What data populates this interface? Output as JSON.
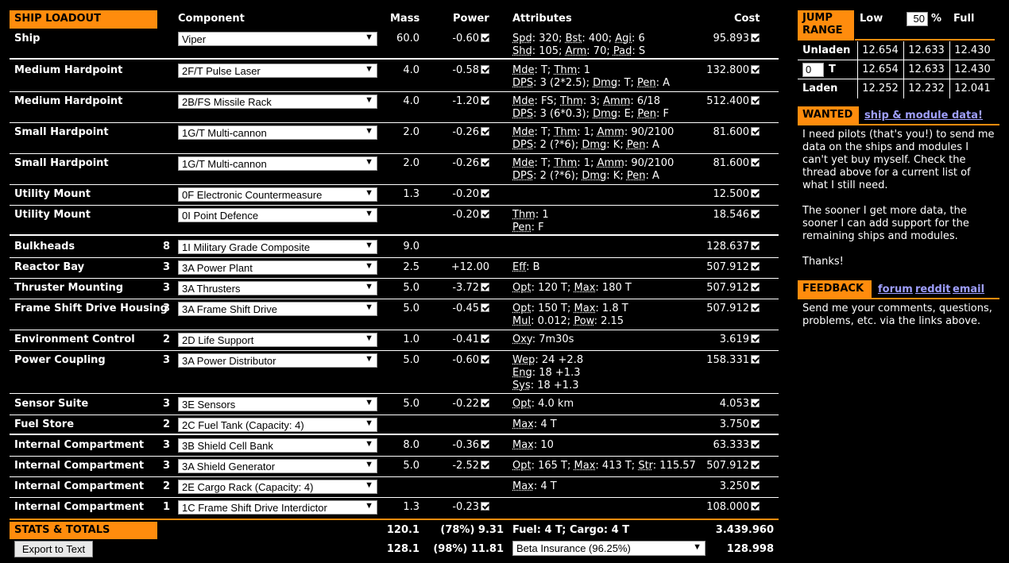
{
  "loadout": {
    "title": "SHIP LOADOUT",
    "headers": {
      "component": "Component",
      "mass": "Mass",
      "power": "Power",
      "attributes": "Attributes",
      "cost": "Cost"
    },
    "rows": [
      {
        "name": "Ship",
        "cls": "",
        "component": "Viper",
        "mass": "60.0",
        "power": "-0.60",
        "attr1": "Spd: 320; Bst: 400; Agi: 6",
        "attr2": "Shd: 105; Arm: 70; Pad: S",
        "attr3": "",
        "cost": "95.893"
      },
      {
        "name": "Medium Hardpoint",
        "cls": "",
        "component": "2F/T Pulse Laser",
        "mass": "4.0",
        "power": "-0.58",
        "attr1": "Mde: T; Thm: 1",
        "attr2": "DPS: 3 (2*2.5); Dmg: T; Pen: A",
        "attr3": "",
        "cost": "132.800"
      },
      {
        "name": "Medium Hardpoint",
        "cls": "",
        "component": "2B/FS Missile Rack",
        "mass": "4.0",
        "power": "-1.20",
        "attr1": "Mde: FS; Thm: 3; Amm: 6/18",
        "attr2": "DPS: 3 (6*0.3); Dmg: E; Pen: F",
        "attr3": "",
        "cost": "512.400"
      },
      {
        "name": "Small Hardpoint",
        "cls": "",
        "component": "1G/T Multi-cannon",
        "mass": "2.0",
        "power": "-0.26",
        "attr1": "Mde: T; Thm: 1; Amm: 90/2100",
        "attr2": "DPS: 2 (?*6); Dmg: K; Pen: A",
        "attr3": "",
        "cost": "81.600"
      },
      {
        "name": "Small Hardpoint",
        "cls": "",
        "component": "1G/T Multi-cannon",
        "mass": "2.0",
        "power": "-0.26",
        "attr1": "Mde: T; Thm: 1; Amm: 90/2100",
        "attr2": "DPS: 2 (?*6); Dmg: K; Pen: A",
        "attr3": "",
        "cost": "81.600"
      },
      {
        "name": "Utility Mount",
        "cls": "",
        "component": "0F Electronic Countermeasure",
        "mass": "1.3",
        "power": "-0.20",
        "attr1": "",
        "attr2": "",
        "attr3": "",
        "cost": "12.500"
      },
      {
        "name": "Utility Mount",
        "cls": "",
        "component": "0I Point Defence",
        "mass": "",
        "power": "-0.20",
        "attr1": "Thm: 1",
        "attr2": "Pen: F",
        "attr3": "",
        "cost": "18.546"
      },
      {
        "name": "Bulkheads",
        "cls": "8",
        "component": "1I Military Grade Composite",
        "mass": "9.0",
        "power": "",
        "attr1": "",
        "attr2": "",
        "attr3": "",
        "cost": "128.637"
      },
      {
        "name": "Reactor Bay",
        "cls": "3",
        "component": "3A Power Plant",
        "mass": "2.5",
        "power": "+12.00",
        "attr1": "Eff: B",
        "attr2": "",
        "attr3": "",
        "cost": "507.912"
      },
      {
        "name": "Thruster Mounting",
        "cls": "3",
        "component": "3A Thrusters",
        "mass": "5.0",
        "power": "-3.72",
        "attr1": "Opt: 120 T; Max: 180 T",
        "attr2": "",
        "attr3": "",
        "cost": "507.912"
      },
      {
        "name": "Frame Shift Drive Housing",
        "cls": "3",
        "component": "3A Frame Shift Drive",
        "mass": "5.0",
        "power": "-0.45",
        "attr1": "Opt: 150 T; Max: 1.8 T",
        "attr2": "Mul: 0.012; Pow: 2.15",
        "attr3": "",
        "cost": "507.912"
      },
      {
        "name": "Environment Control",
        "cls": "2",
        "component": "2D Life Support",
        "mass": "1.0",
        "power": "-0.41",
        "attr1": "Oxy: 7m30s",
        "attr2": "",
        "attr3": "",
        "cost": "3.619"
      },
      {
        "name": "Power Coupling",
        "cls": "3",
        "component": "3A Power Distributor",
        "mass": "5.0",
        "power": "-0.60",
        "attr1": "Wep: 24 +2.8",
        "attr2": "Eng: 18 +1.3",
        "attr3": "Sys: 18 +1.3",
        "cost": "158.331"
      },
      {
        "name": "Sensor Suite",
        "cls": "3",
        "component": "3E Sensors",
        "mass": "5.0",
        "power": "-0.22",
        "attr1": "Opt: 4.0 km",
        "attr2": "",
        "attr3": "",
        "cost": "4.053"
      },
      {
        "name": "Fuel Store",
        "cls": "2",
        "component": "2C Fuel Tank (Capacity: 4)",
        "mass": "",
        "power": "",
        "attr1": "Max: 4 T",
        "attr2": "",
        "attr3": "",
        "cost": "3.750"
      },
      {
        "name": "Internal Compartment",
        "cls": "3",
        "component": "3B Shield Cell Bank",
        "mass": "8.0",
        "power": "-0.36",
        "attr1": "Max: 10",
        "attr2": "",
        "attr3": "",
        "cost": "63.333"
      },
      {
        "name": "Internal Compartment",
        "cls": "3",
        "component": "3A Shield Generator",
        "mass": "5.0",
        "power": "-2.52",
        "attr1": "Opt: 165 T; Max: 413 T; Str: 115.57",
        "attr2": "",
        "attr3": "",
        "cost": "507.912"
      },
      {
        "name": "Internal Compartment",
        "cls": "2",
        "component": "2E Cargo Rack (Capacity: 4)",
        "mass": "",
        "power": "",
        "attr1": "Max: 4 T",
        "attr2": "",
        "attr3": "",
        "cost": "3.250"
      },
      {
        "name": "Internal Compartment",
        "cls": "1",
        "component": "1C Frame Shift Drive Interdictor",
        "mass": "1.3",
        "power": "-0.23",
        "attr1": "",
        "attr2": "",
        "attr3": "",
        "cost": "108.000"
      }
    ]
  },
  "totals": {
    "title": "STATS & TOTALS",
    "mass1": "120.1",
    "power1": "(78%) 9.31",
    "fuel_cargo": "Fuel: 4 T; Cargo: 4 T",
    "cost1": "3.439.960",
    "export_label": "Export to Text",
    "mass2": "128.1",
    "power2": "(98%) 11.81",
    "insurance": "Beta Insurance (96.25%)",
    "cost2": "128.998"
  },
  "jump": {
    "title_line1": "JUMP",
    "title_line2": "RANGE",
    "low": "Low",
    "pct_value": "50",
    "pct_sign": "%",
    "full": "Full",
    "rows": [
      {
        "label": "Unladen",
        "low": "12.654",
        "mid": "12.633",
        "full": "12.430"
      },
      {
        "label": "T",
        "input": "0",
        "low": "12.654",
        "mid": "12.633",
        "full": "12.430"
      },
      {
        "label": "Laden",
        "low": "12.252",
        "mid": "12.232",
        "full": "12.041"
      }
    ]
  },
  "wanted": {
    "title": "WANTED",
    "link": "ship & module data!",
    "p1": "I need pilots (that's you!) to send me data on the ships and modules I can't yet buy myself. Check the thread above for a current list of what I still need.",
    "p2": "The sooner I get more data, the sooner I can add support for the remaining ships and modules.",
    "p3": "Thanks!"
  },
  "feedback": {
    "title": "FEEDBACK",
    "forum": "forum",
    "reddit": "reddit",
    "email": "email",
    "body": "Send me your comments, questions, problems, etc. via the links above."
  },
  "colors": {
    "accent": "#ff8c0d",
    "link": "#9f9fff",
    "background": "#000000"
  }
}
